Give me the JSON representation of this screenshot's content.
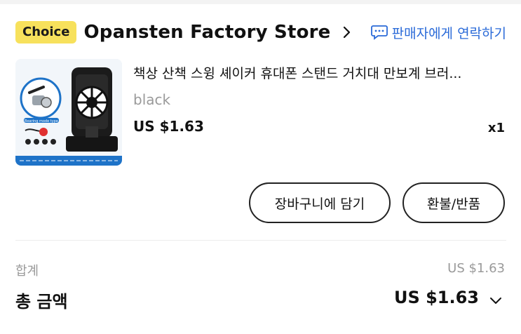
{
  "store": {
    "badge": "Choice",
    "name": "Opansten Factory Store",
    "contact_label": "판매자에게 연락하기"
  },
  "product": {
    "title": "책상 산책 스윙 셰이커 휴대폰 스탠드 거치대 만보계 브러...",
    "variant": "black",
    "price": "US $1.63",
    "quantity": "x1",
    "thumb_caption": "Bearing mode type"
  },
  "actions": {
    "add_to_cart": "장바구니에 담기",
    "refund": "환불/반품"
  },
  "summary": {
    "subtotal_label": "합계",
    "subtotal_value": "US $1.63",
    "total_label": "총 금액",
    "total_value": "US $1.63"
  },
  "colors": {
    "choice_badge": "#f7e15c",
    "link": "#2a6ad8",
    "muted": "#9a9a9a"
  }
}
